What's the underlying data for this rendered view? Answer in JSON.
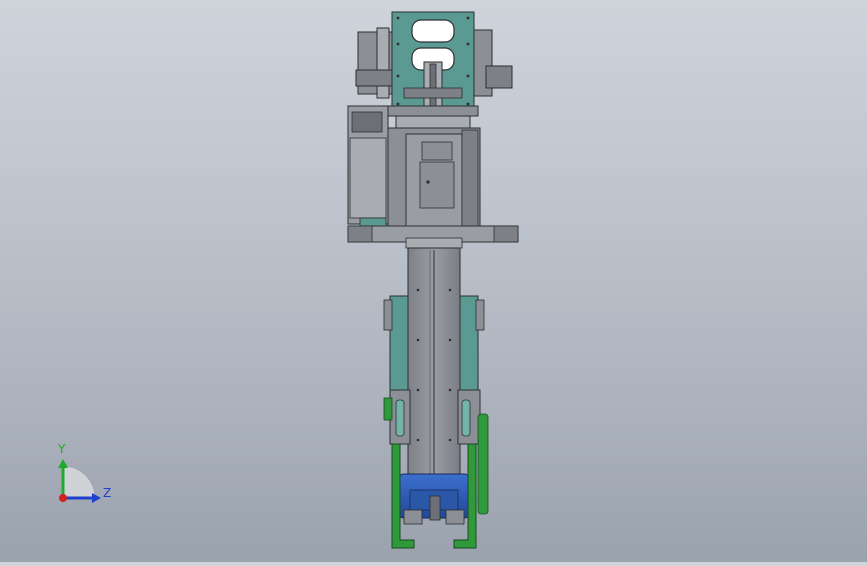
{
  "viewport": {
    "background_top": "#cfd4db",
    "background_bottom": "#9aa2ae"
  },
  "colors": {
    "teal": "#5a9a92",
    "teal_light": "#72b3aa",
    "steel": "#8c9096",
    "steel_dark": "#6c7076",
    "steel_light": "#a9adb2",
    "outline": "#2c2e30",
    "green": "#2f9a3a",
    "blue": "#2f5fb5",
    "copper": "#b08868"
  },
  "triad": {
    "y_label": "Y",
    "z_label": "Z",
    "y_color": "#1faa2e",
    "z_color": "#1f3fcf",
    "x_color": "#d21f1f"
  }
}
